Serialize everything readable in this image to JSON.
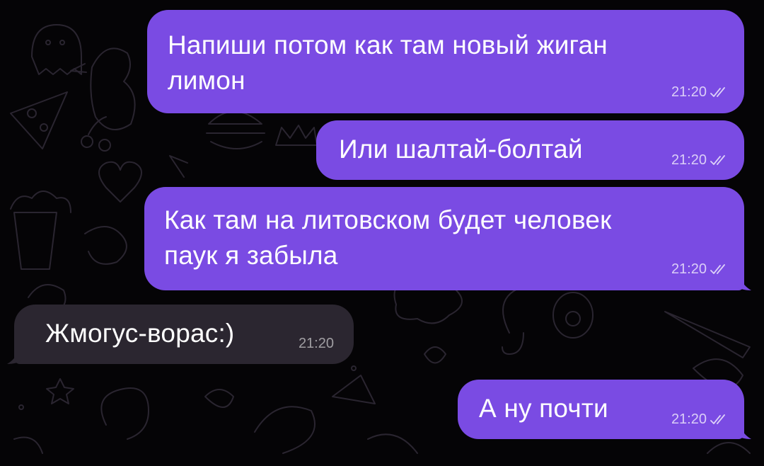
{
  "messages": [
    {
      "direction": "out",
      "lines": [
        "Напиши потом как там новый жиган",
        "лимон"
      ],
      "time": "21:20",
      "read": true
    },
    {
      "direction": "out",
      "lines": [
        "Или шалтай-болтай"
      ],
      "time": "21:20",
      "read": true
    },
    {
      "direction": "out",
      "lines": [
        "Как там на литовском будет человек",
        "паук я забыла"
      ],
      "time": "21:20",
      "read": true
    },
    {
      "direction": "in",
      "lines": [
        "Жмогус-ворас:)"
      ],
      "time": "21:20"
    },
    {
      "direction": "out",
      "lines": [
        "А ну почти"
      ],
      "time": "21:20",
      "read": true
    }
  ],
  "icons": {
    "read_receipt": "double-check-icon",
    "background": "doodle-pattern"
  },
  "colors": {
    "background": "#050406",
    "outgoing_bubble": "#7a4be3",
    "incoming_bubble": "#2b2630",
    "doodle_stroke": "#2a2530"
  }
}
